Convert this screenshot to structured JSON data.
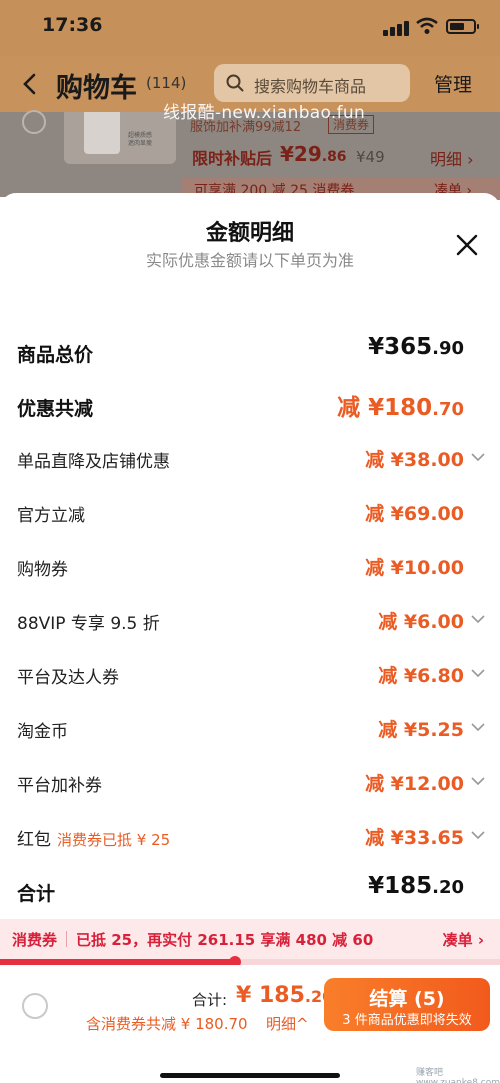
{
  "status_bar": {
    "time": "17:36"
  },
  "header": {
    "back_icon": "back-arrow-icon",
    "title": "购物车",
    "count": "(114)",
    "search_placeholder": "搜索购物车商品",
    "manage_label": "管理"
  },
  "watermark": "线报酷-new.xianbao.fun",
  "background_item": {
    "thumb_text": "超模质感 遮肉显瘦",
    "tag_text": "服饰加补满99减12",
    "tag_badge": "消费券",
    "subsidy_label": "限时补贴后",
    "price_int": "¥29",
    "price_dec": ".86",
    "original_price": "¥49",
    "detail_link": "明细 ›",
    "promo_text": "可享满 200 减 25 消费券",
    "promo_right": "凑单 ›"
  },
  "sheet": {
    "title": "金额明细",
    "subtitle": "实际优惠金额请以下单页为准",
    "close_icon": "close-icon",
    "rows": [
      {
        "label": "商品总价",
        "value_main": "¥365",
        "value_dec": ".90",
        "bold": true
      },
      {
        "label": "优惠共减",
        "value_main": "减 ¥180",
        "value_dec": ".70",
        "bold": true
      },
      {
        "label": "单品直降及店铺优惠",
        "value": "减 ¥38.00",
        "chevron": true
      },
      {
        "label": "官方立减",
        "value": "减 ¥69.00",
        "chevron": false
      },
      {
        "label": "购物券",
        "value": "减 ¥10.00",
        "chevron": false
      },
      {
        "label": "88VIP 专享 9.5 折",
        "value": "减 ¥6.00",
        "chevron": true
      },
      {
        "label": "平台及达人券",
        "value": "减 ¥6.80",
        "chevron": true
      },
      {
        "label": "淘金币",
        "value": "减 ¥5.25",
        "chevron": true
      },
      {
        "label": "平台加补券",
        "value": "减 ¥12.00",
        "chevron": true
      },
      {
        "label": "红包",
        "note": "消费券已抵 ¥ 25",
        "value": "减 ¥33.65",
        "chevron": true
      },
      {
        "label": "合计",
        "value_main": "¥185",
        "value_dec": ".20",
        "bold": true
      }
    ]
  },
  "consumer_voucher": {
    "label": "消费券",
    "text": "已抵 25，再实付 261.15 享满 480 减 60",
    "action": "凑单 ›",
    "progress": 0.47
  },
  "footer": {
    "total_label": "合计:",
    "total_int": "¥ 185",
    "total_dec": ".20",
    "saved_text": "含消费券共减 ¥ 180.70",
    "detail_link": "明细^",
    "checkout_label": "结算 (5)",
    "checkout_sub": "3 件商品优惠即将失效",
    "watermark": "赚客吧 www.zuanke8.com"
  },
  "colors": {
    "accent": "#ea5c24",
    "voucher_red": "#d9203a",
    "header_bg": "#c8925c"
  }
}
